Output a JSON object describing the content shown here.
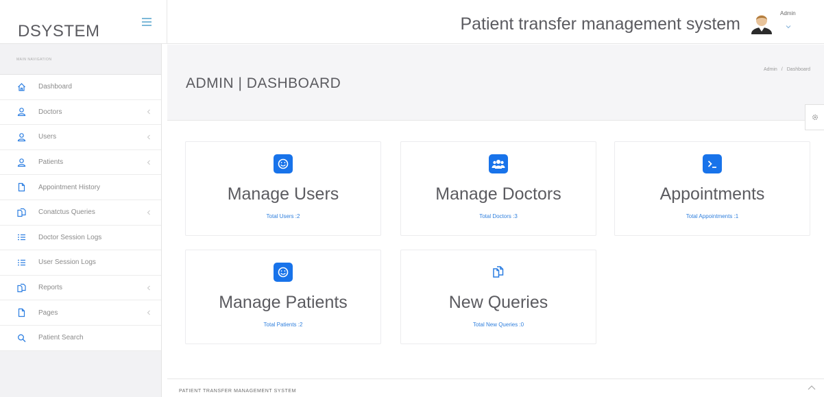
{
  "brand": {
    "name": "DSYSTEM"
  },
  "header": {
    "title": "Patient transfer management system",
    "user_name": "Admin"
  },
  "sidebar": {
    "header": "MAIN NAVIGATION",
    "items": [
      {
        "label": "Dashboard",
        "icon": "home-icon",
        "has_submenu": false
      },
      {
        "label": "Doctors",
        "icon": "user-icon",
        "has_submenu": true
      },
      {
        "label": "Users",
        "icon": "user-icon",
        "has_submenu": true
      },
      {
        "label": "Patients",
        "icon": "user-icon",
        "has_submenu": true
      },
      {
        "label": "Appointment History",
        "icon": "file-icon",
        "has_submenu": false
      },
      {
        "label": "Conatctus Queries",
        "icon": "files-icon",
        "has_submenu": true
      },
      {
        "label": "Doctor Session Logs",
        "icon": "list-icon",
        "has_submenu": false
      },
      {
        "label": "User Session Logs",
        "icon": "list-icon",
        "has_submenu": false
      },
      {
        "label": "Reports",
        "icon": "files-icon",
        "has_submenu": true
      },
      {
        "label": "Pages",
        "icon": "file-icon",
        "has_submenu": true
      },
      {
        "label": "Patient Search",
        "icon": "search-icon",
        "has_submenu": false
      }
    ]
  },
  "page": {
    "title": "ADMIN | DASHBOARD",
    "breadcrumb": [
      "Admin",
      "/",
      "Dashboard"
    ]
  },
  "cards": [
    {
      "title": "Manage Users",
      "link": "Total Users :2",
      "icon": "smile-icon"
    },
    {
      "title": "Manage Doctors",
      "link": "Total Doctors :3",
      "icon": "users-icon"
    },
    {
      "title": "Appointments",
      "link": "Total Appointments :1",
      "icon": "terminal-icon"
    },
    {
      "title": "Manage Patients",
      "link": "Total Patients :2",
      "icon": "smile-icon"
    },
    {
      "title": "New Queries",
      "link": "Total New Queries :0",
      "icon": "files-icon"
    }
  ],
  "footer": {
    "text": "PATIENT TRANSFER MANAGEMENT SYSTEM"
  },
  "colors": {
    "accent": "#1873ea",
    "link": "#2f7fdd",
    "icon": "#2a7de1",
    "toggle": "#7cb8d8"
  }
}
